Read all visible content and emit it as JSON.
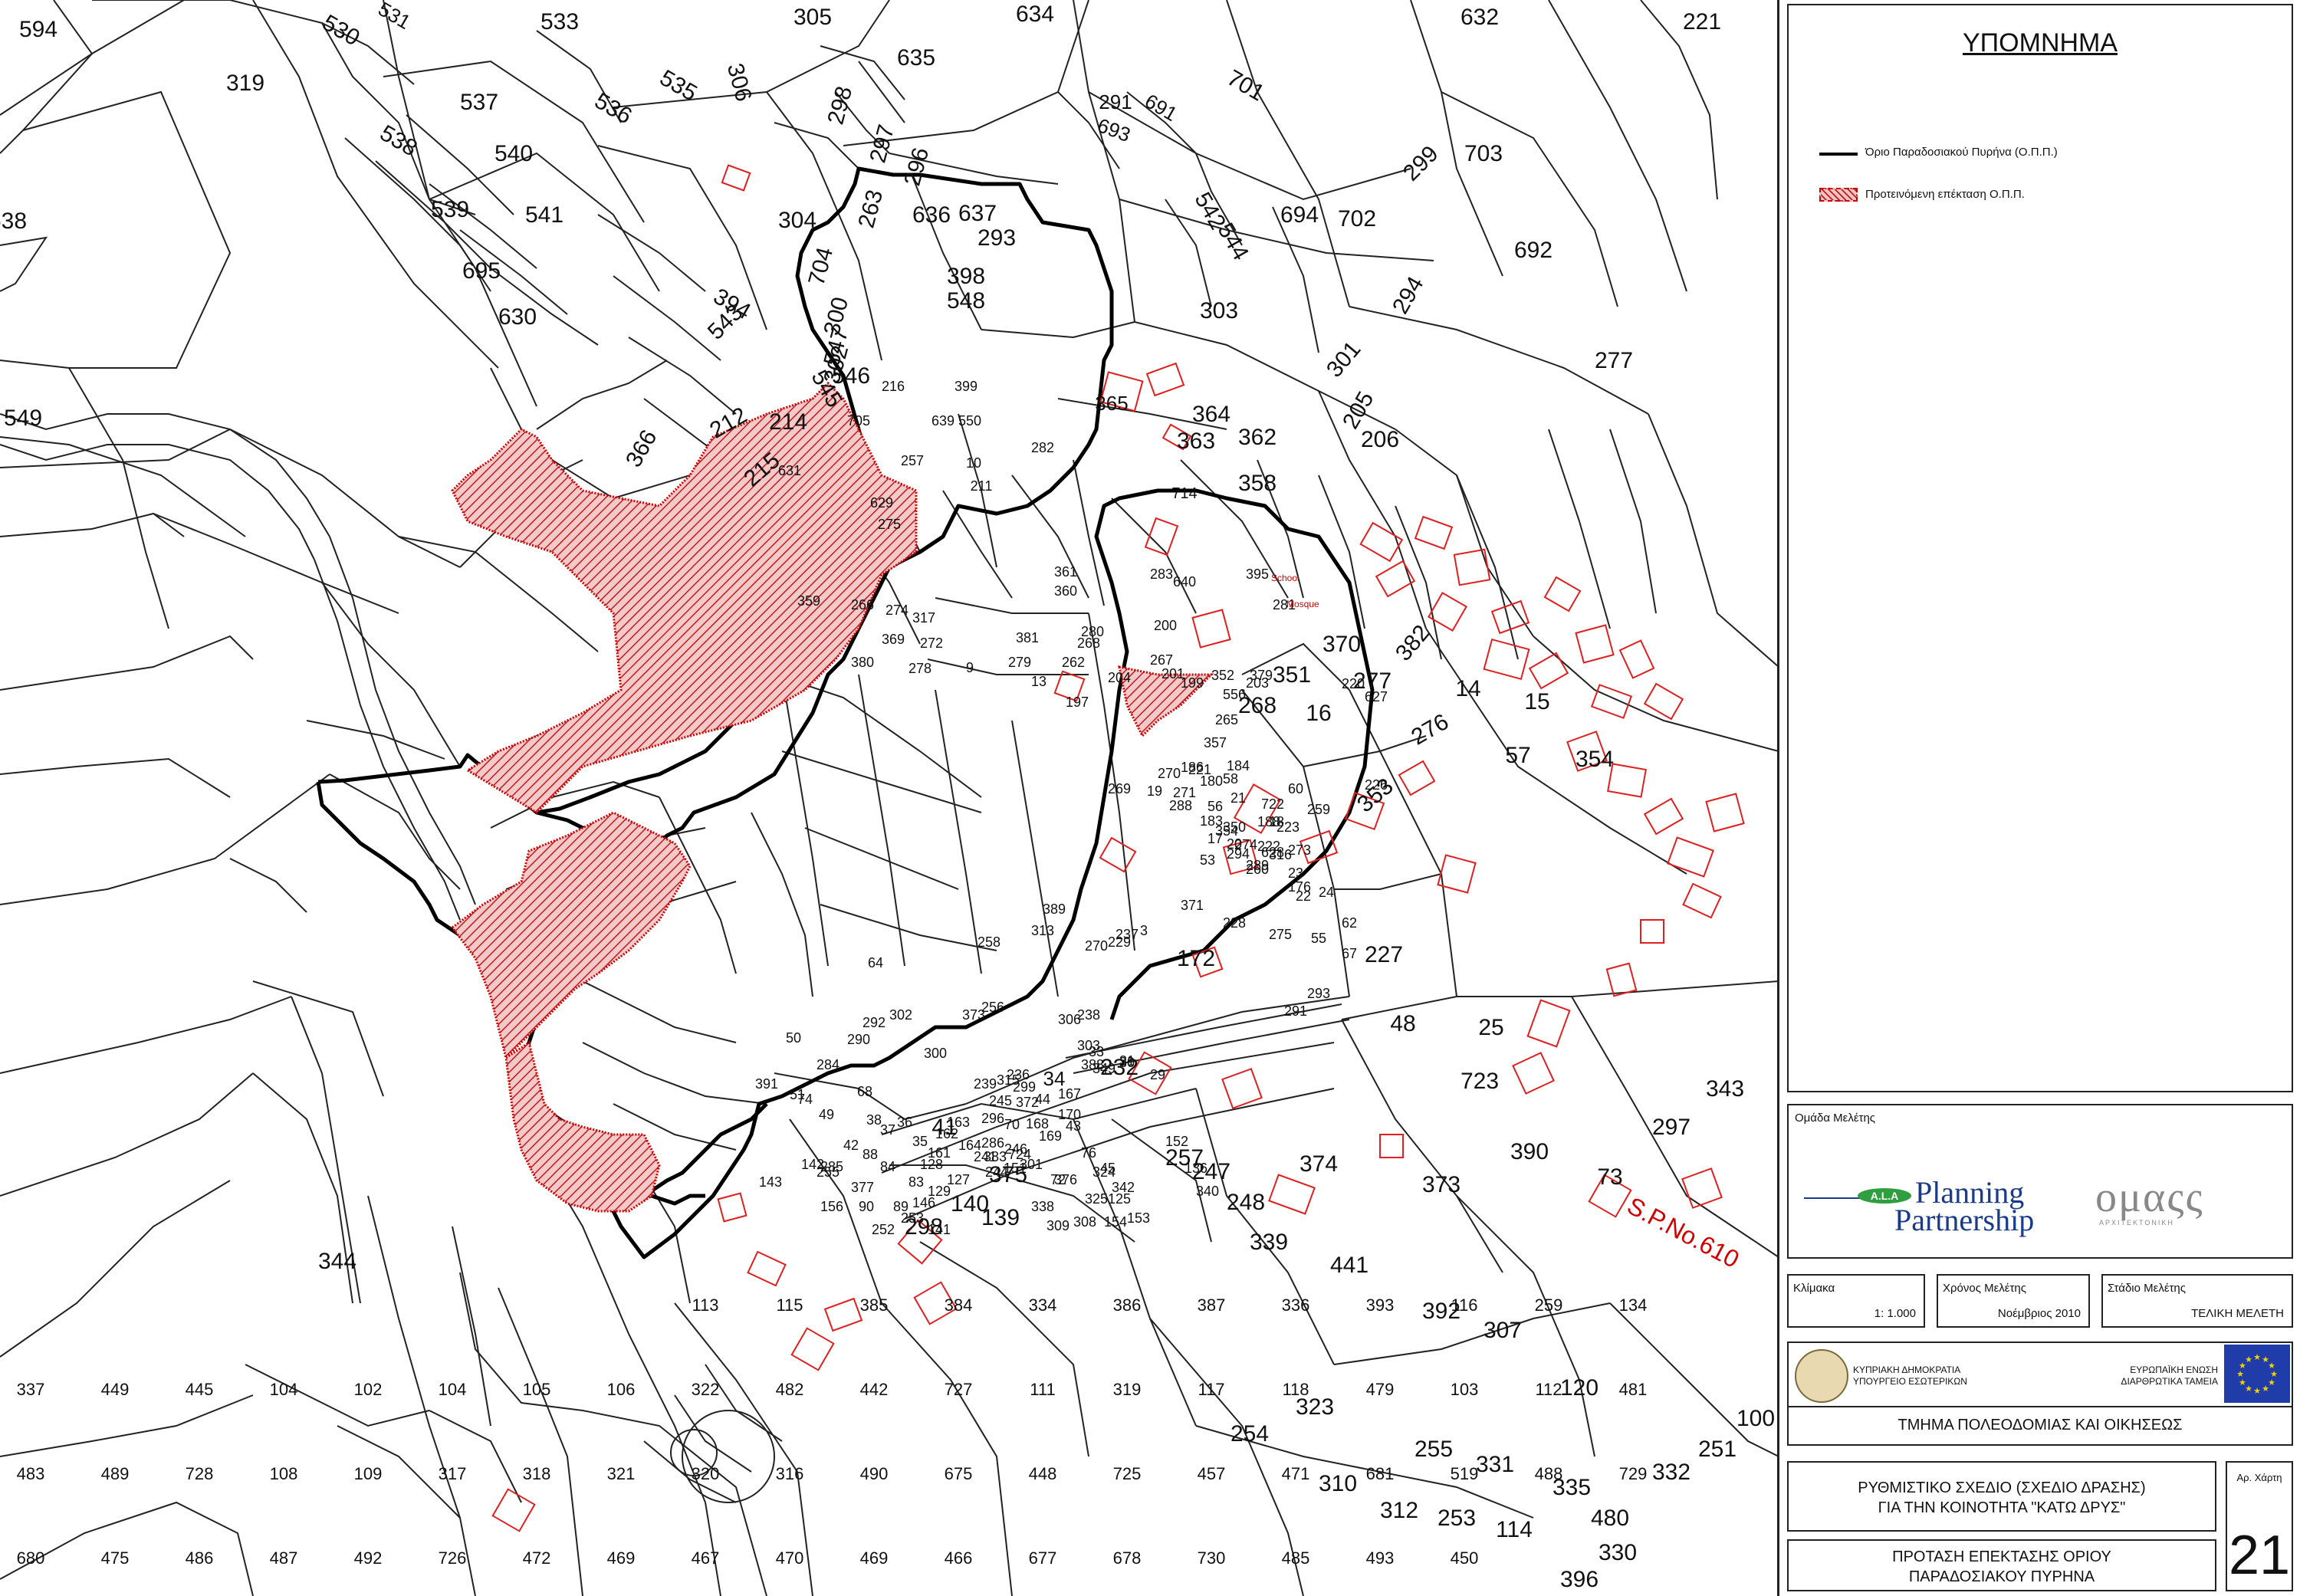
{
  "map": {
    "parcel_numbers": [
      "594",
      "530",
      "531",
      "533",
      "305",
      "634",
      "632",
      "221",
      "319",
      "537",
      "536",
      "535",
      "306",
      "298",
      "635",
      "291",
      "691",
      "693",
      "701",
      "538",
      "540",
      "297",
      "296",
      "703",
      "638",
      "539",
      "541",
      "636",
      "637",
      "293",
      "304",
      "694",
      "702",
      "263",
      "542",
      "544",
      "299",
      "692",
      "695",
      "704",
      "394",
      "548",
      "300",
      "303",
      "294",
      "398",
      "630",
      "543",
      "547",
      "301",
      "277",
      "549",
      "302",
      "545",
      "546",
      "365",
      "364",
      "366",
      "212",
      "214",
      "215",
      "216",
      "399",
      "705",
      "639",
      "550",
      "257",
      "282",
      "10",
      "211",
      "363",
      "362",
      "206",
      "205",
      "358",
      "631",
      "629",
      "275",
      "714",
      "640",
      "395",
      "281",
      "283",
      "361",
      "360",
      "359",
      "266",
      "274",
      "317",
      "381",
      "279",
      "280",
      "204",
      "369",
      "272",
      "380",
      "278",
      "9",
      "262",
      "268",
      "200",
      "201",
      "199",
      "556",
      "268",
      "379",
      "267",
      "13",
      "197",
      "352",
      "351",
      "370",
      "382",
      "277",
      "14",
      "265",
      "357",
      "15",
      "16",
      "353",
      "354",
      "203",
      "220",
      "627",
      "270",
      "269",
      "271",
      "276",
      "57",
      "17",
      "18",
      "183",
      "186",
      "184",
      "180",
      "221",
      "260",
      "316",
      "722",
      "273",
      "274",
      "58",
      "56",
      "288",
      "19",
      "21",
      "350",
      "188",
      "354",
      "222",
      "223",
      "628",
      "259",
      "60",
      "294",
      "53",
      "289",
      "20",
      "23",
      "22",
      "24",
      "176",
      "226",
      "227",
      "228",
      "371",
      "172",
      "229",
      "238",
      "232",
      "237",
      "270",
      "388",
      "3",
      "275",
      "291",
      "293",
      "62",
      "67",
      "55",
      "48",
      "25",
      "29",
      "31",
      "30",
      "33",
      "349",
      "373",
      "256",
      "257",
      "258",
      "313",
      "389",
      "303",
      "306",
      "302",
      "300",
      "290",
      "292",
      "64",
      "68",
      "51",
      "50",
      "49",
      "41",
      "34",
      "167",
      "168",
      "169",
      "170",
      "239",
      "236",
      "372",
      "245",
      "315",
      "296",
      "299",
      "70",
      "286",
      "44",
      "43",
      "42",
      "285",
      "284",
      "38",
      "37",
      "36",
      "35",
      "161",
      "162",
      "163",
      "164",
      "241",
      "244",
      "246",
      "301",
      "72",
      "76",
      "45",
      "342",
      "247",
      "248",
      "374",
      "373",
      "723",
      "390",
      "73",
      "297",
      "343",
      "344",
      "143",
      "142",
      "255",
      "391",
      "74",
      "88",
      "84",
      "83",
      "146",
      "141",
      "140",
      "139",
      "375",
      "724",
      "298",
      "128",
      "156",
      "377",
      "253",
      "252",
      "90",
      "89",
      "129",
      "127",
      "383",
      "151",
      "338",
      "376",
      "309",
      "308",
      "324",
      "325",
      "125",
      "154",
      "153",
      "152",
      "136",
      "340",
      "339",
      "441",
      "392",
      "307",
      "120",
      "323",
      "255",
      "331",
      "335",
      "480",
      "254",
      "310",
      "312",
      "253",
      "114",
      "396",
      "330",
      "332",
      "251",
      "100",
      "113",
      "115",
      "385",
      "384",
      "334",
      "386",
      "387",
      "336",
      "393",
      "116",
      "259",
      "134",
      "337",
      "449",
      "445",
      "104",
      "102",
      "104",
      "105",
      "106",
      "322",
      "482",
      "442",
      "727",
      "111",
      "319",
      "117",
      "118",
      "479",
      "103",
      "112",
      "481",
      "483",
      "489",
      "728",
      "108",
      "109",
      "317",
      "318",
      "321",
      "320",
      "316",
      "490",
      "675",
      "448",
      "725",
      "457",
      "471",
      "681",
      "519",
      "488",
      "729",
      "680",
      "475",
      "486",
      "487",
      "492",
      "726",
      "472",
      "469",
      "467",
      "470",
      "469",
      "466",
      "677",
      "678",
      "730",
      "485",
      "493",
      "450"
    ],
    "map_labels": [
      "School",
      "Mosque",
      "S.P.No.610"
    ]
  },
  "legend": {
    "title": "ΥΠΟΜΝΗΜΑ",
    "items": [
      {
        "label": "Όριο Παραδοσιακού Πυρήνα (Ο.Π.Π.)",
        "symbol": "black-line"
      },
      {
        "label": "Προτεινόμενη επέκταση Ο.Π.Π.",
        "symbol": "red-hatch"
      }
    ]
  },
  "study_team": {
    "heading": "Ομάδα Μελέτης",
    "logo_ala": "A.L.A",
    "logo_planning": "Planning",
    "logo_partnership": "Partnership",
    "logo_omada": "ομαςς",
    "logo_omada_sub": "ΑΡΧΙΤΕΚΤΟΝΙΚΗ"
  },
  "info": {
    "scale_label": "Κλίμακα",
    "scale_value": "1: 1.000",
    "date_label": "Χρόνος Μελέτης",
    "date_value": "Νοέμβριος 2010",
    "stage_label": "Στάδιο Μελέτης",
    "stage_value": "ΤΕΛΙΚΗ ΜΕΛΕΤΗ"
  },
  "org": {
    "republic_line1": "ΚΥΠΡΙΑΚΗ ΔΗΜΟΚΡΑΤΙΑ",
    "republic_line2": "ΥΠΟΥΡΓΕΙΟ ΕΣΩΤΕΡΙΚΩΝ",
    "eu_line1": "ΕΥΡΩΠΑΪΚΗ ΕΝΩΣΗ",
    "eu_line2": "ΔΙΑΡΘΡΩΤΙΚΑ ΤΑΜΕΙΑ",
    "department": "ΤΜΗΜΑ ΠΟΛΕΟΔΟΜΙΑΣ ΚΑΙ ΟΙΚΗΣΕΩΣ"
  },
  "project": {
    "title_line1": "ΡΥΘΜΙΣΤΙΚΟ ΣΧΕΔΙΟ (ΣΧΕΔΙΟ ΔΡΑΣΗΣ)",
    "title_line2": "ΓΙΑ ΤΗΝ ΚΟΙΝΟΤΗΤΑ \"ΚΑΤΩ ΔΡΥΣ\"",
    "map_no_label": "Αρ. Χάρτη",
    "map_no": "21",
    "subtitle_line1": "ΠΡΟΤΑΣΗ ΕΠΕΚΤΑΣΗΣ ΟΡΙΟΥ",
    "subtitle_line2": "ΠΑΡΑΔΟΣΙΑΚΟΥ ΠΥΡΗΝΑ"
  },
  "colors": {
    "boundary": "#000000",
    "extension": "#d00000",
    "extension_fill": "#f1c4c4",
    "eu_blue": "#1f3ca8",
    "eu_star": "#f2d100",
    "logo_blue": "#1a3a8a",
    "logo_green": "#2e9e3e"
  }
}
